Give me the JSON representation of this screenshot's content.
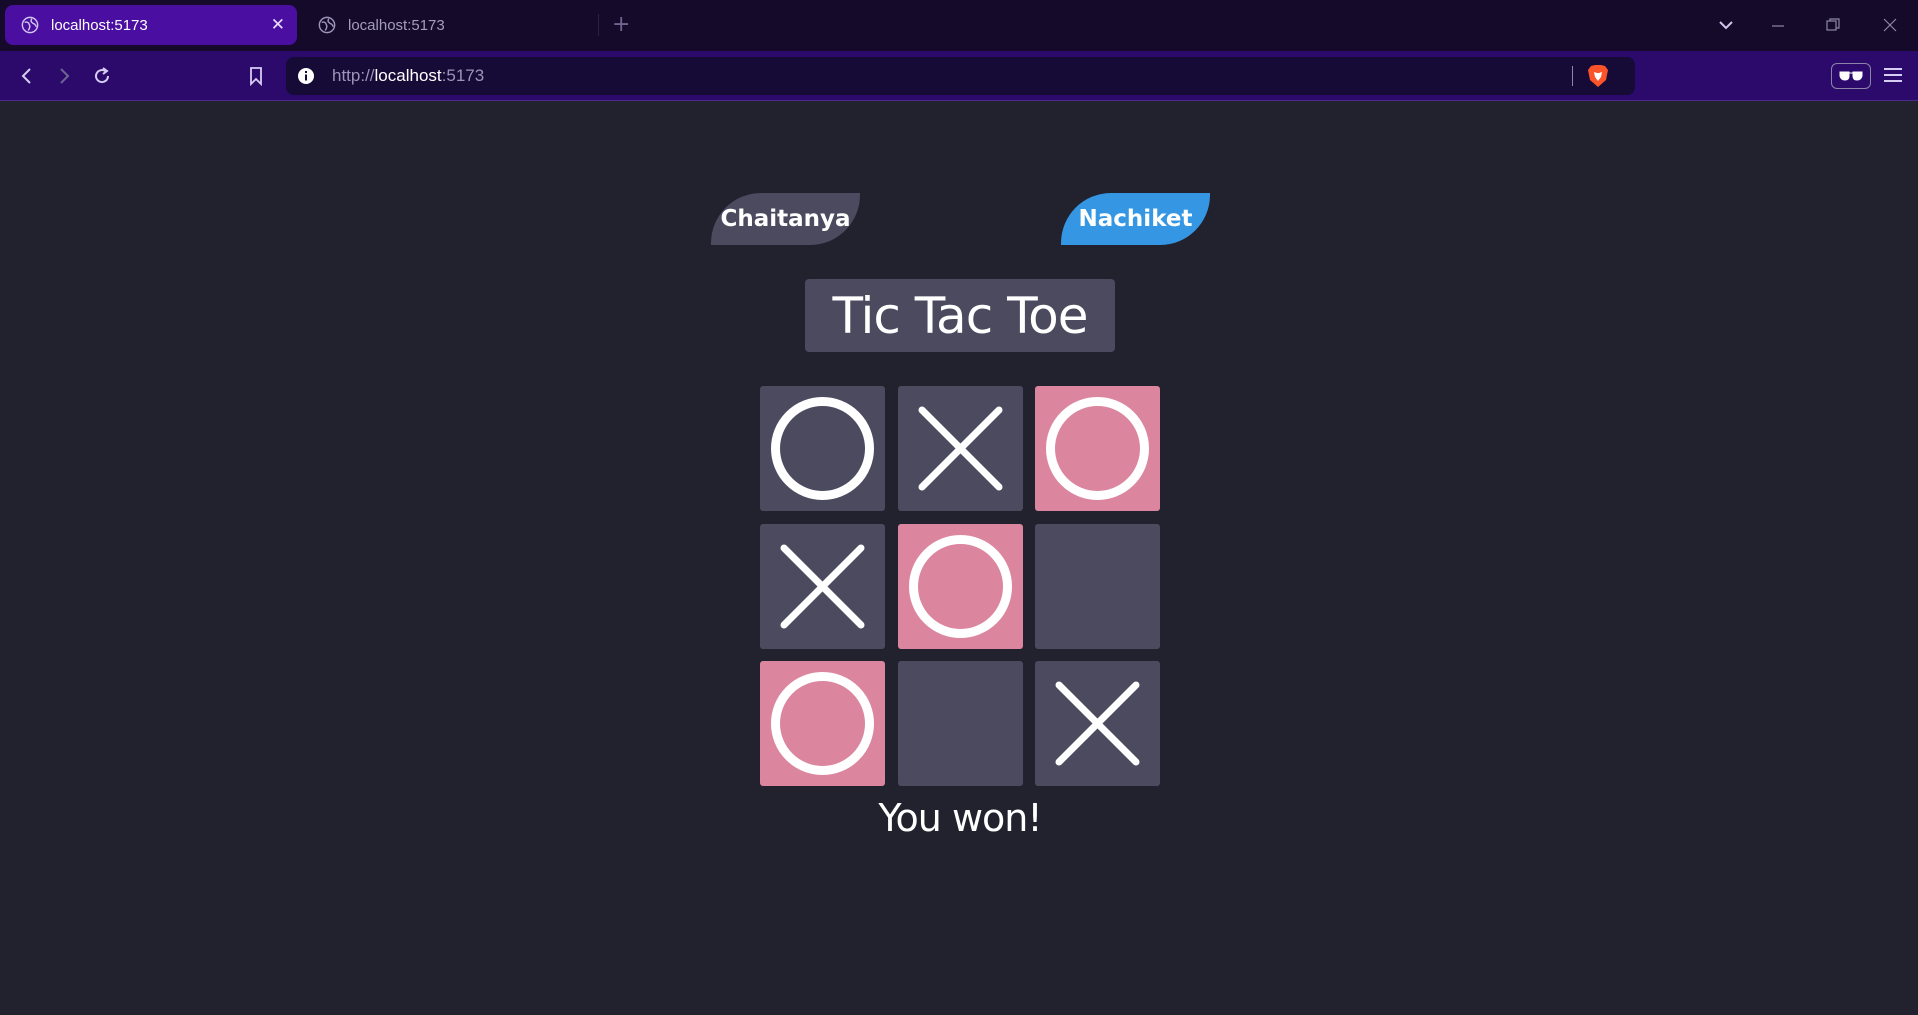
{
  "browser": {
    "tabs": [
      {
        "label": "localhost:5173",
        "active": true
      },
      {
        "label": "localhost:5173",
        "active": false
      }
    ],
    "url_scheme": "http://",
    "url_host": "localhost",
    "url_port": ":5173"
  },
  "game": {
    "player_left": "Chaitanya",
    "player_right": "Nachiket",
    "active_player_color": "#3597e4",
    "title": "Tic Tac Toe",
    "status": "You won!",
    "win_color": "#dc859f",
    "board": [
      {
        "mark": "O",
        "win": false
      },
      {
        "mark": "X",
        "win": false
      },
      {
        "mark": "O",
        "win": true
      },
      {
        "mark": "X",
        "win": false
      },
      {
        "mark": "O",
        "win": true
      },
      {
        "mark": "",
        "win": false
      },
      {
        "mark": "O",
        "win": true
      },
      {
        "mark": "",
        "win": false
      },
      {
        "mark": "X",
        "win": false
      }
    ]
  }
}
